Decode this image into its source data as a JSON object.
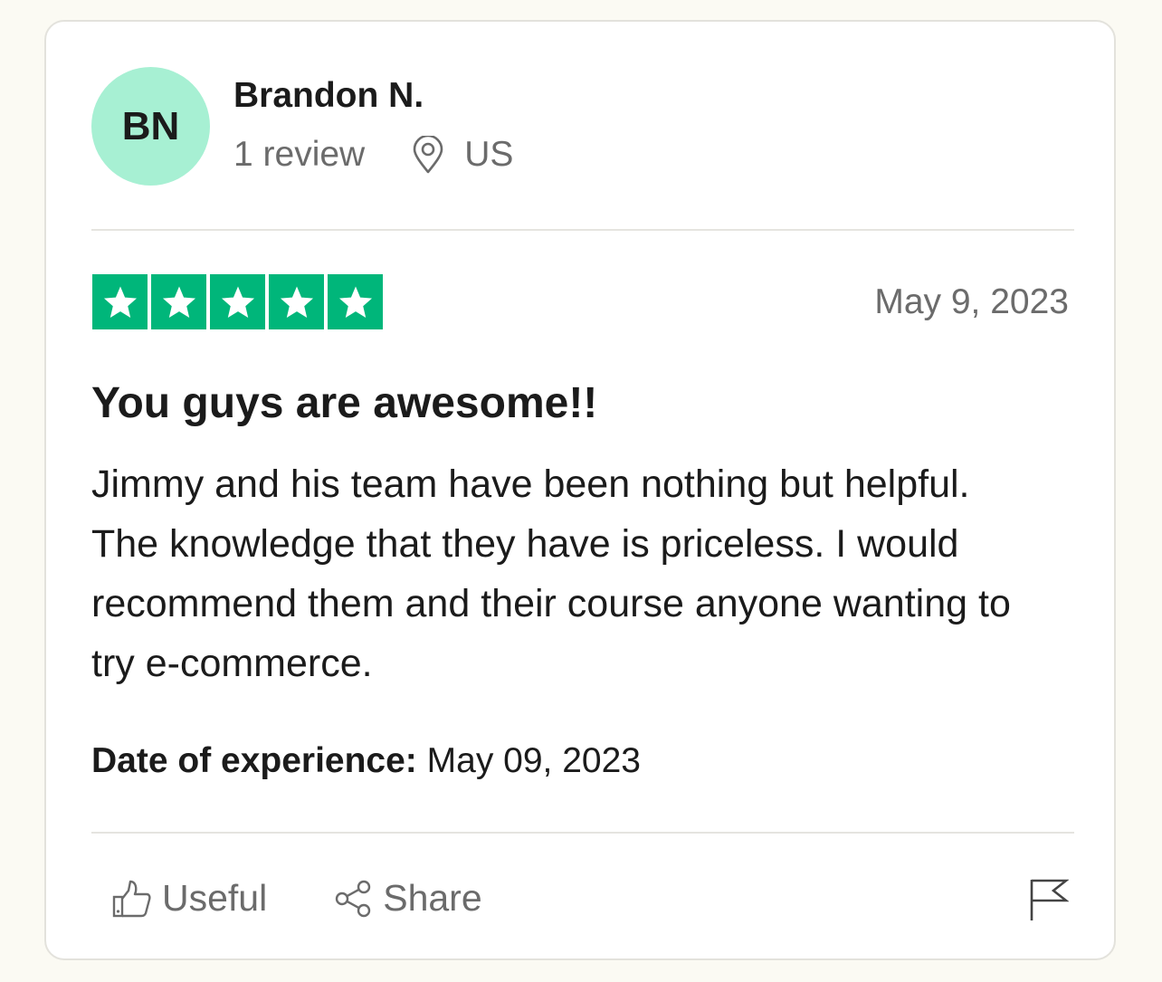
{
  "reviewer": {
    "initials": "BN",
    "name": "Brandon N.",
    "review_count": "1 review",
    "location": "US"
  },
  "review": {
    "rating": 5,
    "max_rating": 5,
    "date": "May 9, 2023",
    "title": "You guys are awesome!!",
    "body": "Jimmy and his team have been nothing but helpful. The knowledge that they have is priceless. I would recommend them and their course anyone wanting to try e-commerce.",
    "experience_label": "Date of experience:",
    "experience_date": "May 09, 2023"
  },
  "actions": {
    "useful_label": "Useful",
    "share_label": "Share"
  },
  "colors": {
    "star_green": "#00b67a",
    "avatar_bg": "#a7f0d3",
    "page_bg": "#fbfaf3"
  },
  "icons": [
    "map-pin-icon",
    "star-icon",
    "thumbs-up-icon",
    "share-icon",
    "flag-icon"
  ]
}
